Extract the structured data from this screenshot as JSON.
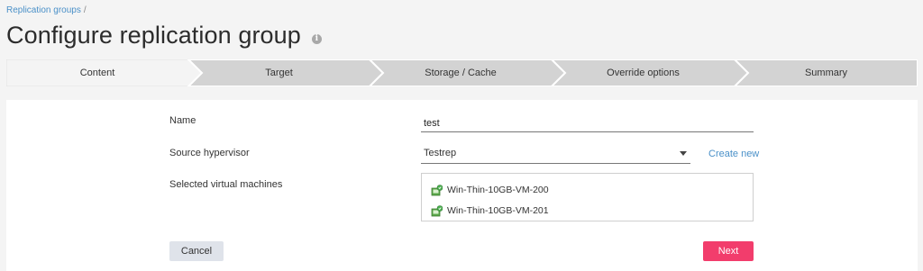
{
  "breadcrumb": {
    "item": "Replication groups",
    "separator": "/"
  },
  "page": {
    "title": "Configure replication group",
    "info_icon": "i"
  },
  "wizard": {
    "steps": [
      {
        "label": "Content",
        "active": true
      },
      {
        "label": "Target",
        "active": false
      },
      {
        "label": "Storage / Cache",
        "active": false
      },
      {
        "label": "Override options",
        "active": false
      },
      {
        "label": "Summary",
        "active": false
      }
    ]
  },
  "form": {
    "name": {
      "label": "Name",
      "value": "test"
    },
    "source_hypervisor": {
      "label": "Source hypervisor",
      "value": "Testrep",
      "create_link": "Create new"
    },
    "selected_vms": {
      "label": "Selected virtual machines",
      "items": [
        "Win-Thin-10GB-VM-200",
        "Win-Thin-10GB-VM-201"
      ],
      "icon": "vm-running-icon"
    }
  },
  "actions": {
    "cancel": "Cancel",
    "next": "Next"
  },
  "colors": {
    "accent": "#f23d6c",
    "link": "#4a90c8",
    "active_step": "#f4f4f4",
    "inactive_step": "#d3d3d3"
  }
}
